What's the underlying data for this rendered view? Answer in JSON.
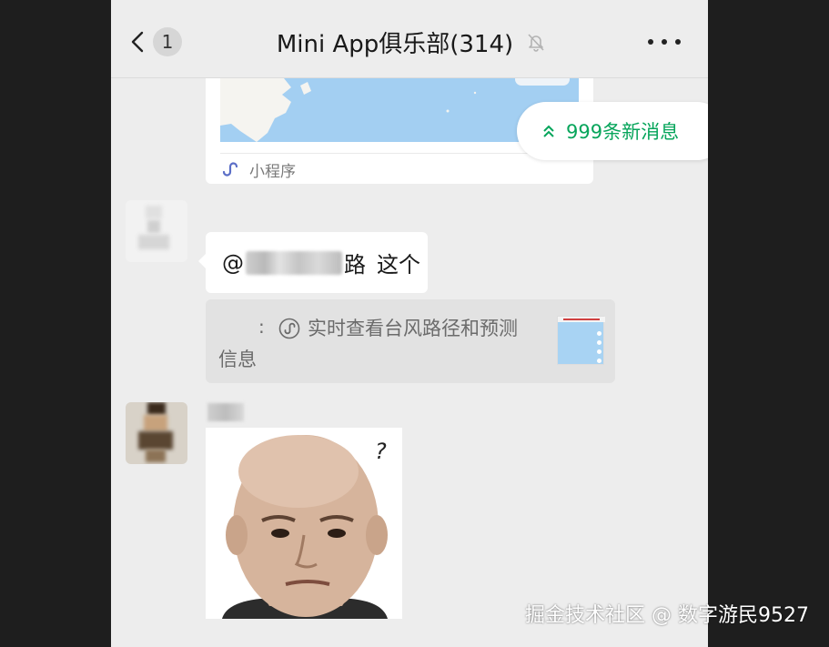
{
  "header": {
    "back_count": "1",
    "title": "Mini App俱乐部(314)",
    "icons": {
      "back": "chevron-left-icon",
      "mute": "bell-off-icon",
      "more": "more-dots-icon"
    }
  },
  "mini_program_card": {
    "footer_label": "小程序",
    "icon": "mini-program-link-icon"
  },
  "new_messages_pill": {
    "label": "999条新消息",
    "icon": "double-chevron-up-icon",
    "color": "#07a55b"
  },
  "messages": [
    {
      "type": "text",
      "mention_prefix": "@",
      "mention_suffix": "路",
      "text": "这个"
    }
  ],
  "quote": {
    "colon": ":",
    "line1": "实时查看台风路径和预测",
    "line2": "信息",
    "icon": "mini-program-link-icon"
  },
  "sticker": {
    "question_mark": "?"
  },
  "watermark": {
    "text": "掘金技术社区 @ 数字游民9527"
  },
  "colors": {
    "chat_background": "#ededed",
    "bubble": "#ffffff",
    "quote_background": "#e2e2e2",
    "accent_green": "#07a55b",
    "frame": "#1e1e1e"
  }
}
